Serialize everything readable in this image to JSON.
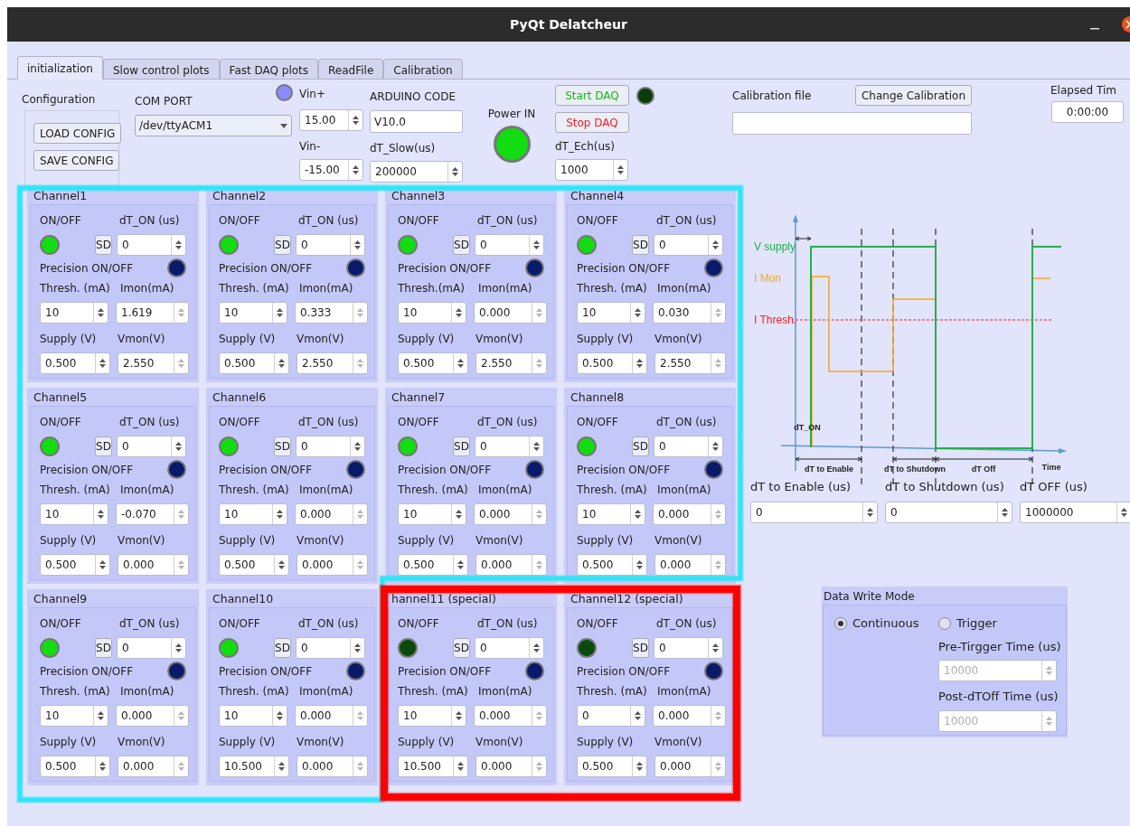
{
  "window": {
    "title": "PyQt Delatcheur"
  },
  "tabs": [
    {
      "label": "initialization",
      "selected": true
    },
    {
      "label": "Slow control plots",
      "selected": false
    },
    {
      "label": "Fast DAQ plots",
      "selected": false
    },
    {
      "label": "ReadFile",
      "selected": false
    },
    {
      "label": "Calibration",
      "selected": false
    }
  ],
  "configuration": {
    "label": "Configuration",
    "buttons": [
      "LOAD CONFIG",
      "SAVE CONFIG"
    ]
  },
  "com_port": {
    "label": "COM PORT",
    "value": "/dev/ttyACM1"
  },
  "vin_plus": {
    "label": "Vin+",
    "value": "15.00"
  },
  "vin_minus": {
    "label": "Vin-",
    "value": "-15.00"
  },
  "arduino_code": {
    "label": "ARDUINO CODE",
    "value": "V10.0"
  },
  "dt_slow": {
    "label": "dT_Slow(us)",
    "value": "200000"
  },
  "power_in": {
    "label": "Power IN",
    "on": true
  },
  "daq": {
    "start_label": "Start DAQ",
    "stop_label": "Stop DAQ",
    "running": false,
    "dt_ech_label": "dT_Ech(us)",
    "dt_ech": "1000"
  },
  "calibration": {
    "label": "Calibration file",
    "button": "Change Calibration"
  },
  "elapsed": {
    "label": "Elapsed Tim",
    "value": "0:00:00"
  },
  "channels": [
    {
      "title": "Channel1",
      "on": true,
      "precision_on": false,
      "sd": "SD",
      "dt_on": "0",
      "thresh": "10",
      "imon": "1.619",
      "supply": "0.500",
      "vmon": "2.550",
      "labels": [
        "ON/OFF",
        "dT_ON (us)",
        "Precision ON/OFF",
        "Thresh. (mA)",
        "Imon(mA)",
        "Supply (V)",
        "Vmon(V)"
      ]
    },
    {
      "title": "Channel2",
      "on": true,
      "precision_on": false,
      "sd": "SD",
      "dt_on": "0",
      "thresh": "10",
      "imon": "0.333",
      "supply": "0.500",
      "vmon": "2.550",
      "labels": [
        "ON/OFF",
        "dT_ON (us)",
        "Precision ON/OFF",
        "Thresh. (mA)",
        "Imon(mA)",
        "Supply (V)",
        "Vmon(V)"
      ]
    },
    {
      "title": "Channel3",
      "on": true,
      "precision_on": false,
      "sd": "SD",
      "dt_on": "0",
      "thresh": "10",
      "imon": "0.000",
      "supply": "0.500",
      "vmon": "2.550",
      "labels": [
        "ON/OFF",
        "dT_ON (us)",
        "Precision ON/OFF",
        "Thresh.(mA)",
        "Imon(mA)",
        "Supply (V)",
        "Vmon(V)"
      ]
    },
    {
      "title": "Channel4",
      "on": true,
      "precision_on": false,
      "sd": "SD",
      "dt_on": "0",
      "thresh": "10",
      "imon": "0.030",
      "supply": "0.500",
      "vmon": "2.550",
      "labels": [
        "ON/OFF",
        "dT_ON (us)",
        "Precision ON/OFF",
        "Thresh. (mA)",
        "Imon(mA)",
        "Supply (V)",
        "Vmon(V)"
      ]
    },
    {
      "title": "Channel5",
      "on": true,
      "precision_on": false,
      "sd": "SD",
      "dt_on": "0",
      "thresh": "10",
      "imon": "-0.070",
      "supply": "0.500",
      "vmon": "0.000",
      "labels": [
        "ON/OFF",
        "dT_ON (us)",
        "Precision ON/OFF",
        "Thresh. (mA)",
        "Imon(mA)",
        "Supply (V)",
        "Vmon(V)"
      ]
    },
    {
      "title": "Channel6",
      "on": true,
      "precision_on": false,
      "sd": "SD",
      "dt_on": "0",
      "thresh": "10",
      "imon": "0.000",
      "supply": "0.500",
      "vmon": "0.000",
      "labels": [
        "ON/OFF",
        "dT_ON (us)",
        "Precision ON/OFF",
        "Thresh. (mA)",
        "Imon(mA)",
        "Supply (V)",
        "Vmon(V)"
      ]
    },
    {
      "title": "Channel7",
      "on": true,
      "precision_on": false,
      "sd": "SD",
      "dt_on": "0",
      "thresh": "10",
      "imon": "0.000",
      "supply": "0.500",
      "vmon": "0.000",
      "labels": [
        "ON/OFF",
        "dT_ON (us)",
        "Precision ON/OFF",
        "Thresh. (mA)",
        "Imon(mA)",
        "Supply (V)",
        "Vmon(V)"
      ]
    },
    {
      "title": "Channel8",
      "on": true,
      "precision_on": false,
      "sd": "SD",
      "dt_on": "0",
      "thresh": "10",
      "imon": "0.000",
      "supply": "0.500",
      "vmon": "0.000",
      "labels": [
        "ON/OFF",
        "dT_ON (us)",
        "Precision ON/OFF",
        "Thresh. (mA)",
        "Imon(mA)",
        "Supply (V)",
        "Vmon(V)"
      ]
    },
    {
      "title": "Channel9",
      "on": true,
      "precision_on": false,
      "sd": "SD",
      "dt_on": "0",
      "thresh": "10",
      "imon": "0.000",
      "supply": "0.500",
      "vmon": "0.000",
      "labels": [
        "ON/OFF",
        "dT_ON (us)",
        "Precision ON/OFF",
        "Thresh. (mA)",
        "Imon(mA)",
        "Supply (V)",
        "Vmon(V)"
      ]
    },
    {
      "title": "Channel10",
      "on": true,
      "precision_on": false,
      "sd": "SD",
      "dt_on": "0",
      "thresh": "10",
      "imon": "0.000",
      "supply": "10.500",
      "vmon": "0.000",
      "labels": [
        "ON/OFF",
        "dT_ON (us)",
        "Precision ON/OFF",
        "Thresh. (mA)",
        "Imon(mA)",
        "Supply (V)",
        "Vmon(V)"
      ]
    },
    {
      "title": "hannel11 (special)",
      "on": false,
      "precision_on": false,
      "sd": "SD",
      "dt_on": "0",
      "thresh": "10",
      "imon": "0.000",
      "supply": "10.500",
      "vmon": "0.000",
      "labels": [
        "ON/OFF",
        "dT_ON (us)",
        "Precision ON/OFF",
        "Thresh. (mA)",
        "Imon(mA)",
        "Supply (V)",
        "Vmon(V)"
      ]
    },
    {
      "title": "Channel12 (special)",
      "on": false,
      "precision_on": false,
      "sd": "SD",
      "dt_on": "0",
      "thresh": "0",
      "imon": "0.000",
      "supply": "0.500",
      "vmon": "0.000",
      "labels": [
        "ON/OFF",
        "dT_ON (us)",
        "Precision ON/OFF",
        "Thresh. (mA)",
        "Imon(mA)",
        "Supply (V)",
        "Vmon(V)"
      ]
    }
  ],
  "timing_diagram": {
    "labels": [
      {
        "kind": "vsupply",
        "text": "V supply"
      },
      {
        "kind": "imon",
        "text": "I Mon"
      },
      {
        "kind": "ithresh",
        "text": "I Thresh."
      },
      {
        "kind": "dton",
        "text": "dT_ON"
      },
      {
        "kind": "enable",
        "text": "dT to Enable"
      },
      {
        "kind": "shutdown",
        "text": "dT to Shutdown"
      },
      {
        "kind": "off",
        "text": "dT Off"
      },
      {
        "kind": "time",
        "text": "Time"
      }
    ]
  },
  "delays": [
    {
      "label": "dT to Enable (us)",
      "value": "0"
    },
    {
      "label": "dT to Shutdown (us)",
      "value": "0"
    },
    {
      "label": "dT OFF (us)",
      "value": "1000000"
    }
  ],
  "data_write_mode": {
    "title": "Data Write Mode",
    "modes": [
      {
        "label": "Continuous",
        "selected": true
      },
      {
        "label": "Trigger",
        "selected": false
      }
    ],
    "fields": [
      {
        "label": "Pre-Tirgger Time (us)",
        "value": "10000",
        "disabled": true
      },
      {
        "label": "Post-dTOff Time (us)",
        "value": "10000",
        "disabled": true
      }
    ]
  },
  "highlights": [
    {
      "color": "#2ee6f7"
    },
    {
      "color": "#ff0000"
    }
  ]
}
